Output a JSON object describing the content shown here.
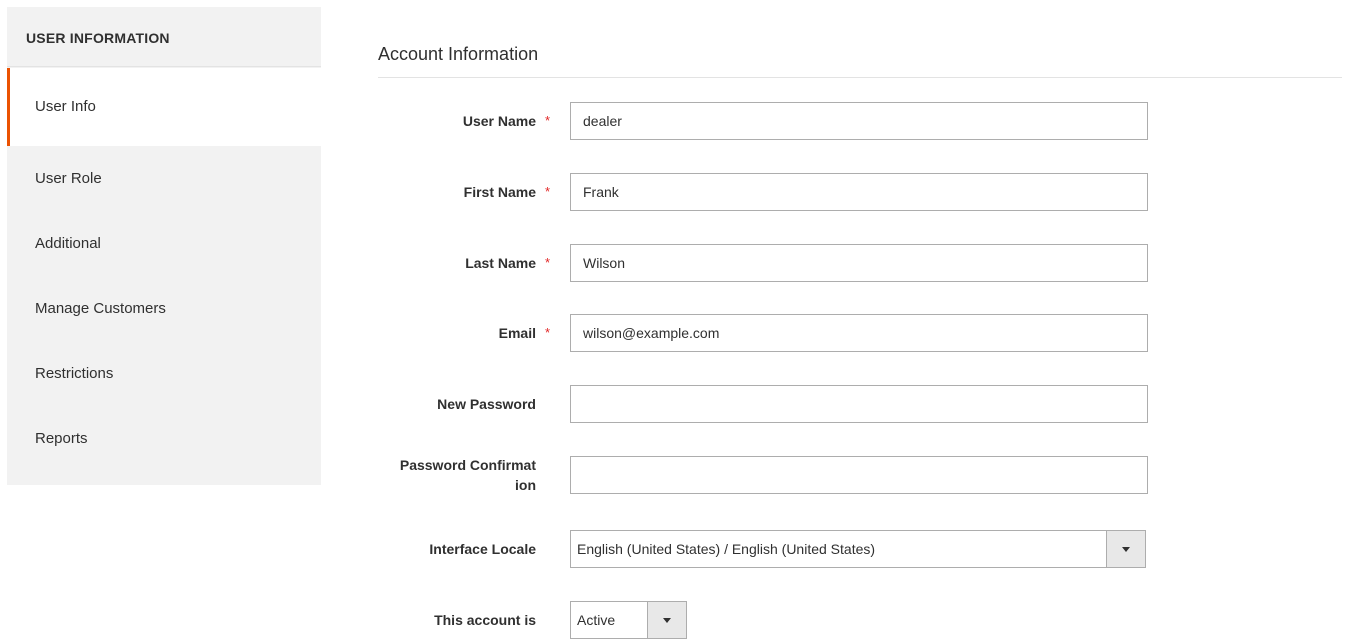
{
  "sidebar": {
    "title": "USER INFORMATION",
    "items": [
      {
        "label": "User Info",
        "active": true
      },
      {
        "label": "User Role",
        "active": false
      },
      {
        "label": "Additional",
        "active": false
      },
      {
        "label": "Manage Customers",
        "active": false
      },
      {
        "label": "Restrictions",
        "active": false
      },
      {
        "label": "Reports",
        "active": false
      }
    ]
  },
  "main": {
    "section_title": "Account Information",
    "required_marker": "*",
    "fields": {
      "user_name": {
        "label": "User Name",
        "value": "dealer",
        "required": true
      },
      "first_name": {
        "label": "First Name",
        "value": "Frank",
        "required": true
      },
      "last_name": {
        "label": "Last Name",
        "value": "Wilson",
        "required": true
      },
      "email": {
        "label": "Email",
        "value": "wilson@example.com",
        "required": true
      },
      "new_password": {
        "label": "New Password",
        "value": "",
        "required": false
      },
      "password_confirmation": {
        "label_line1": "Password Confirmat",
        "label_line2": "ion",
        "value": "",
        "required": false
      },
      "interface_locale": {
        "label": "Interface Locale",
        "value": "English (United States) / English (United States)"
      },
      "account_status": {
        "label": "This account is",
        "value": "Active"
      }
    }
  },
  "colors": {
    "accent": "#eb5202",
    "required": "#e22626",
    "sidebar_bg": "#f2f2f2",
    "border": "#adadad"
  }
}
